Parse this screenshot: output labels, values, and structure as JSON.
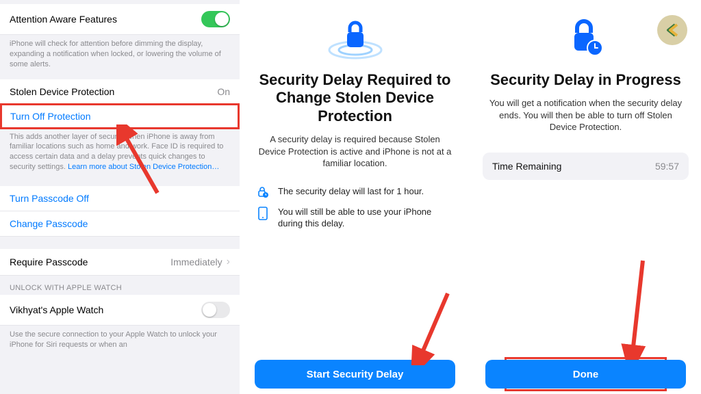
{
  "left": {
    "aaf_label": "Attention Aware Features",
    "aaf_desc": "iPhone will check for attention before dimming the display, expanding a notification when locked, or lowering the volume of some alerts.",
    "sdp_label": "Stolen Device Protection",
    "sdp_value": "On",
    "turn_off_label": "Turn Off Protection",
    "sdp_desc": "This adds another layer of security when iPhone is away from familiar locations such as home and work. Face ID is required to access certain data and a delay prevents quick changes to security settings. ",
    "sdp_learn": "Learn more about Stolen Device Protection…",
    "turn_passcode_off": "Turn Passcode Off",
    "change_passcode": "Change Passcode",
    "require_passcode": "Require Passcode",
    "require_passcode_value": "Immediately",
    "unlock_header": "UNLOCK WITH APPLE WATCH",
    "watch_label": "Vikhyat's Apple Watch",
    "watch_desc": "Use the secure connection to your Apple Watch to unlock your iPhone for Siri requests or when an"
  },
  "mid": {
    "title": "Security Delay Required to Change Stolen Device Protection",
    "lead": "A security delay is required because Stolen Device Protection is active and iPhone is not at a familiar location.",
    "row1": "The security delay will last for 1 hour.",
    "row2": "You will still be able to use your iPhone during this delay.",
    "button": "Start Security Delay"
  },
  "right": {
    "title": "Security Delay in Progress",
    "lead": "You will get a notification when the security delay ends. You will then be able to turn off Stolen Device Protection.",
    "time_label": "Time Remaining",
    "time_value": "59:57",
    "button": "Done"
  }
}
